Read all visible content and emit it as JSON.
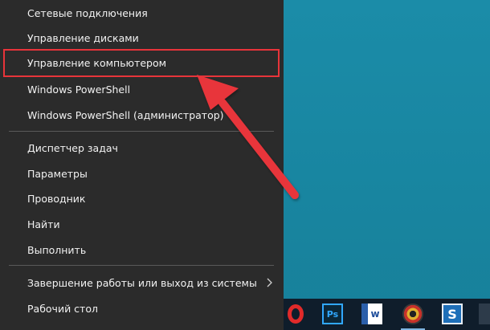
{
  "menu": {
    "items": [
      {
        "label": "Сетевые подключения"
      },
      {
        "label": "Управление дисками"
      },
      {
        "label": "Управление компьютером"
      },
      {
        "label": "Windows PowerShell"
      },
      {
        "label": "Windows PowerShell (администратор)"
      },
      {
        "label": "Диспетчер задач"
      },
      {
        "label": "Параметры"
      },
      {
        "label": "Проводник"
      },
      {
        "label": "Найти"
      },
      {
        "label": "Выполнить"
      },
      {
        "label": "Завершение работы или выход из системы"
      },
      {
        "label": "Рабочий стол"
      }
    ]
  },
  "taskbar": {
    "icons": [
      {
        "name": "opera-icon"
      },
      {
        "name": "photoshop-icon",
        "text": "Ps"
      },
      {
        "name": "word-icon",
        "text": "w"
      },
      {
        "name": "disc-burner-icon"
      },
      {
        "name": "snagit-icon",
        "text": "S"
      }
    ]
  },
  "colors": {
    "menu_bg": "#2b2b2b",
    "desktop_bg": "#1a8aa6",
    "highlight_red": "#e8343a",
    "taskbar_bg": "#0f1d2b"
  }
}
